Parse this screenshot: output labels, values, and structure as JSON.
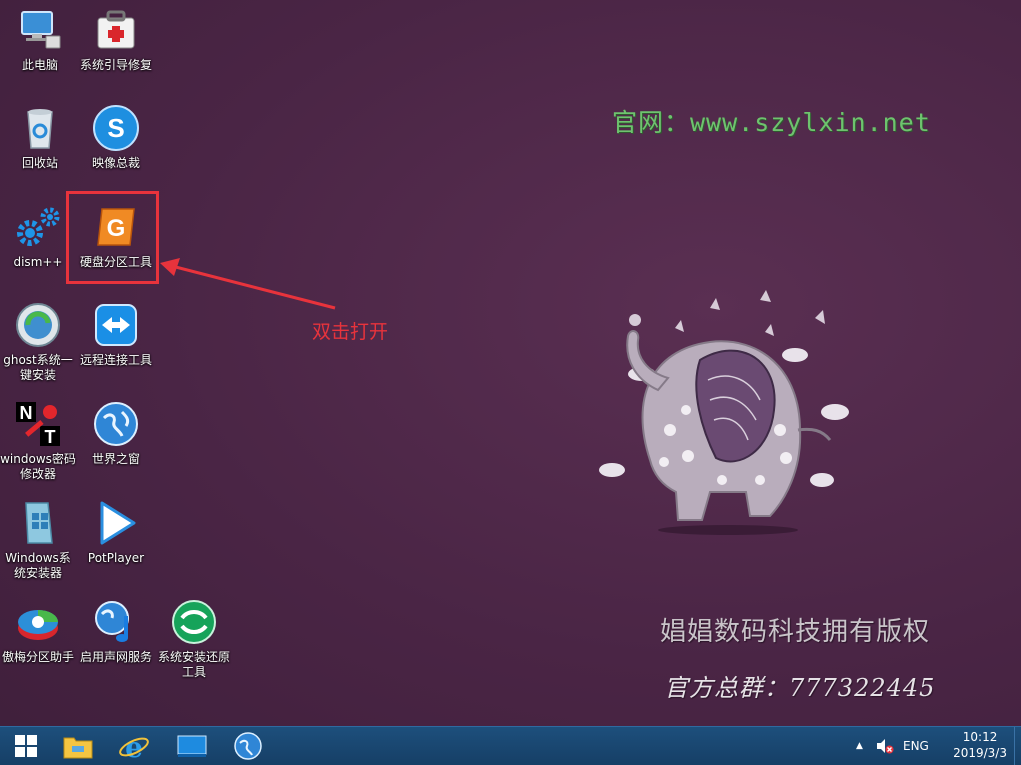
{
  "desktop": {
    "icons": [
      {
        "label": "此电脑",
        "icon": "computer-icon"
      },
      {
        "label": "系统引导修复",
        "icon": "first-aid-kit-icon"
      },
      {
        "label": "回收站",
        "icon": "recycle-bin-icon"
      },
      {
        "label": "映像总裁",
        "icon": "image-master-icon"
      },
      {
        "label": "dism++",
        "icon": "gears-icon"
      },
      {
        "label": "硬盘分区工具",
        "icon": "diskgenius-icon"
      },
      {
        "label": "ghost系统一\n键安装",
        "icon": "ghost-install-icon"
      },
      {
        "label": "远程连接工具",
        "icon": "teamviewer-icon"
      },
      {
        "label": "windows密码\n修改器",
        "icon": "nt-password-icon"
      },
      {
        "label": "世界之窗",
        "icon": "globe-browser-icon"
      },
      {
        "label": "Windows系\n统安装器",
        "icon": "windows-installer-icon"
      },
      {
        "label": "PotPlayer",
        "icon": "potplayer-icon"
      },
      {
        "label": "傲梅分区助手",
        "icon": "aomei-partition-icon"
      },
      {
        "label": "启用声网服务",
        "icon": "sound-network-icon"
      },
      {
        "label": "系统安装还原\n工具",
        "icon": "system-restore-icon"
      }
    ]
  },
  "annotation": {
    "text": "双击打开",
    "color": "#e8333c"
  },
  "wallpaper": {
    "site": "官网：www.szylxin.net",
    "copyright": "娼娼数码科技拥有版权",
    "group": "官方总群：777322445"
  },
  "taskbar": {
    "start": "windows-start-icon",
    "pinned": [
      "file-explorer-icon",
      "internet-explorer-icon",
      "desktop-window-icon",
      "globe-browser-icon"
    ],
    "tray": {
      "chevron": "▲",
      "volume": "muted-speaker-icon",
      "language": "ENG",
      "time": "10:12",
      "date": "2019/3/3"
    }
  },
  "colors": {
    "background": "#4a2545",
    "taskbar": "#1d4f7c",
    "highlight": "#e8333c",
    "site_watermark": "#6ec36e"
  }
}
